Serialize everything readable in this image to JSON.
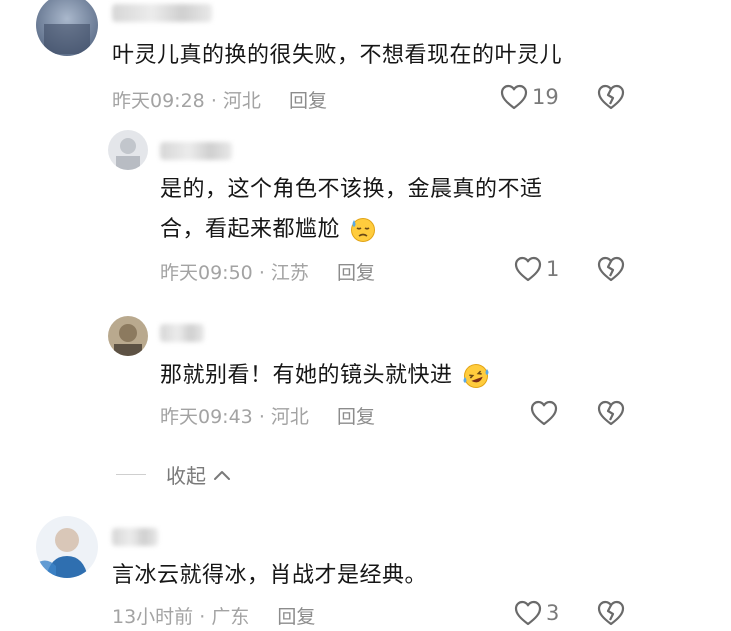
{
  "comments": [
    {
      "text": "叶灵儿真的换的很失败，不想看现在的叶灵儿",
      "time": "昨天09:28",
      "location": "河北",
      "reply": "回复",
      "likes": "19",
      "replies": [
        {
          "text_line1": "是的，这个角色不该换，金晨真的不适",
          "text_line2": "合，看起来都尴尬",
          "emoji": "sweat-face-icon",
          "time": "昨天09:50",
          "location": "江苏",
          "reply": "回复",
          "likes": "1"
        },
        {
          "text": "那就别看！有她的镜头就快进",
          "emoji": "rofl-face-icon",
          "time": "昨天09:43",
          "location": "河北",
          "reply": "回复",
          "likes": ""
        }
      ],
      "collapse_label": "收起"
    },
    {
      "text": "言冰云就得冰，肖战才是经典。",
      "time": "13小时前",
      "location": "广东",
      "reply": "回复",
      "likes": "3"
    }
  ],
  "separator": "·"
}
